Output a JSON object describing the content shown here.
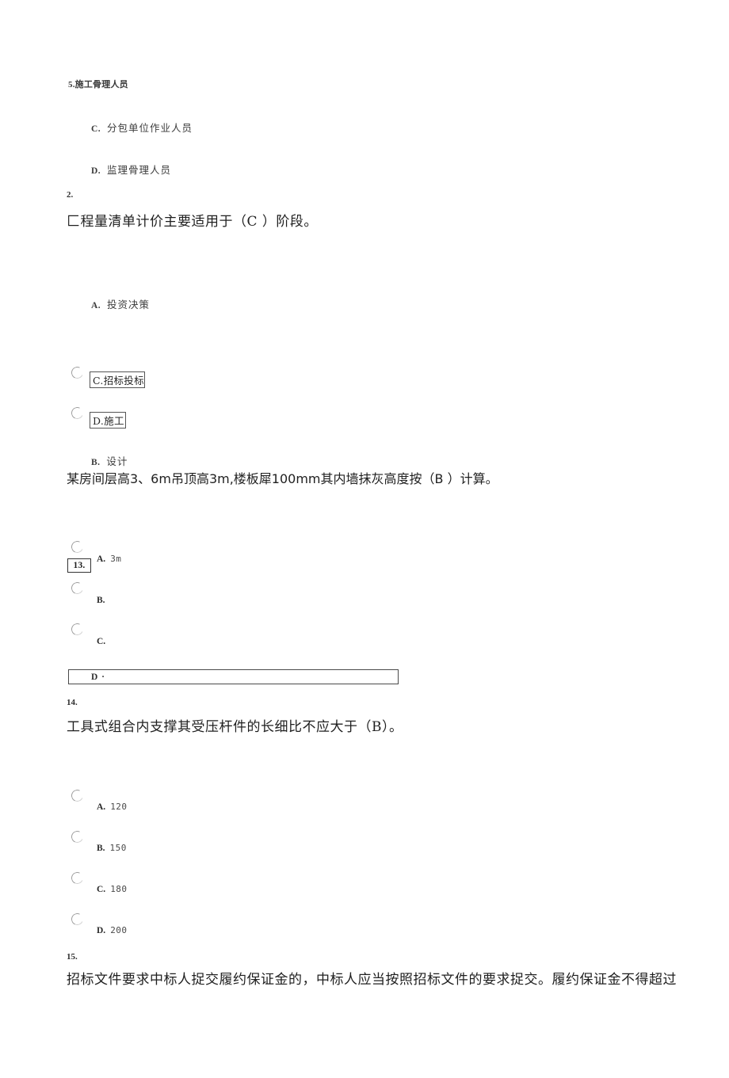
{
  "document": {
    "type": "exam-quiz-page",
    "background_color": "#ffffff",
    "text_color": "#2b2b2b"
  },
  "blocks": {
    "orphan_option_b": "5.施工骨理人员",
    "orphan_option_c_label": "C.",
    "orphan_option_c_text": "分包单位作业人员",
    "orphan_option_d_label": "D.",
    "orphan_option_d_text": "监理骨理人员"
  },
  "question_2": {
    "number": "2.",
    "stem": "匚程量清单计价主要适用于（C ）阶段。",
    "option_a_label": "A.",
    "option_a_text": "投资决策",
    "option_c_boxed": "C.招标投标",
    "option_d_boxed": "D.施工",
    "option_b_label": "B.",
    "option_b_text": "设计"
  },
  "question_13": {
    "number_boxed": "13.",
    "stem": "某房间层高3、6m吊顶高3m,楼板犀100mm其内墙抹灰高度按（B ）计算。",
    "options": [
      {
        "label": "A.",
        "text": "3m"
      },
      {
        "label": "B.",
        "text": ""
      },
      {
        "label": "C.",
        "text": ""
      }
    ],
    "option_d_field": "D ·"
  },
  "question_14": {
    "number": "14.",
    "stem": "工具式组合内支撑其受压杆件的长细比不应大于（B）。",
    "options": [
      {
        "label": "A.",
        "text": "120"
      },
      {
        "label": "B.",
        "text": "150"
      },
      {
        "label": "C.",
        "text": "180"
      },
      {
        "label": "D.",
        "text": "200"
      }
    ]
  },
  "question_15": {
    "number": "15.",
    "stem": "招标文件要求中标人捉交履约保证金的，中标人应当按照招标文件的要求捉交。履约保证金不得超过"
  }
}
